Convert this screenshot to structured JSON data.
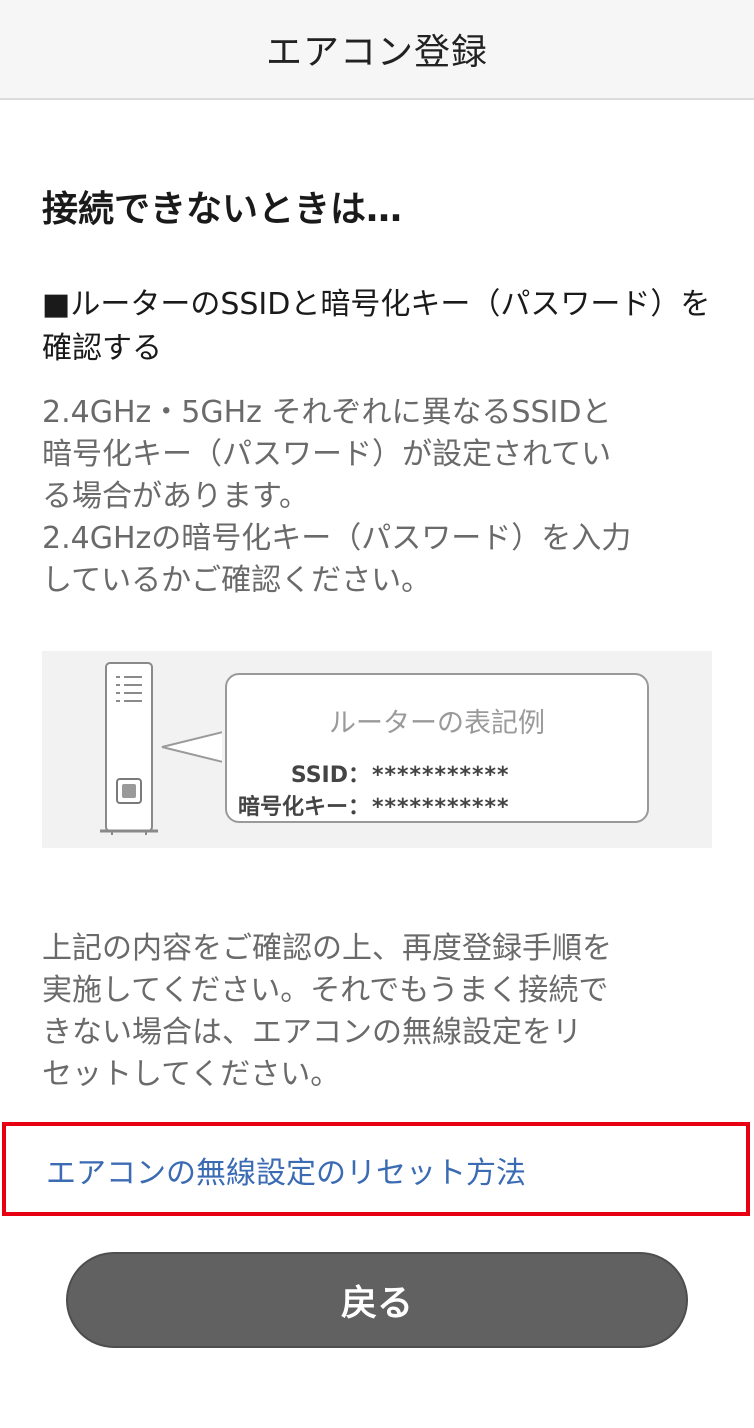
{
  "header": {
    "title": "エアコン登録"
  },
  "main": {
    "heading": "接続できないときは…",
    "subheading": "■ルーターのSSIDと暗号化キー（パスワード）を確認する",
    "description_lines": [
      "2.4GHz・5GHz それぞれに異なるSSIDと",
      "暗号化キー（パスワード）が設定されてい",
      "る場合があります。",
      "2.4GHzの暗号化キー（パスワード）を入力",
      "しているかご確認ください。"
    ],
    "example": {
      "title": "ルーターの表記例",
      "ssid_label": "SSID：",
      "ssid_value": "***********",
      "key_label": "暗号化キー：",
      "key_value": "***********"
    },
    "after_lines": [
      "上記の内容をご確認の上、再度登録手順を",
      "実施してください。それでもうまく接続で",
      "きない場合は、エアコンの無線設定をリ",
      "セットしてください。"
    ],
    "reset_link": "エアコンの無線設定のリセット方法",
    "back_button": "戻る"
  },
  "colors": {
    "link": "#3a6bb3",
    "highlight_border": "#e60012",
    "button_bg": "#616161"
  },
  "icons": {
    "router": "router-icon"
  }
}
